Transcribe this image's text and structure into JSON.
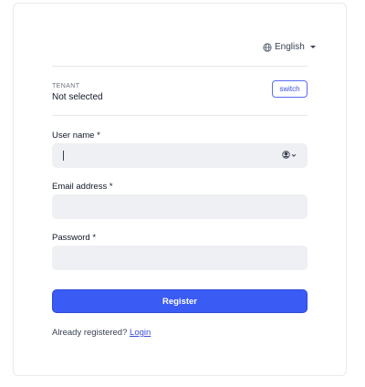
{
  "language": {
    "label": "English",
    "icon": "globe-icon"
  },
  "tenant": {
    "caption": "TENANT",
    "value": "Not selected",
    "switch_label": "switch"
  },
  "form": {
    "username": {
      "label": "User name *",
      "value": "",
      "icon": "user-circle-icon"
    },
    "email": {
      "label": "Email address *",
      "value": ""
    },
    "password": {
      "label": "Password *",
      "value": ""
    },
    "submit_label": "Register"
  },
  "footer": {
    "prompt": "Already registered?",
    "login_label": "Login"
  },
  "colors": {
    "primary": "#3b5bf5",
    "field_bg": "#eef0f3",
    "link": "#3b4fd8"
  }
}
